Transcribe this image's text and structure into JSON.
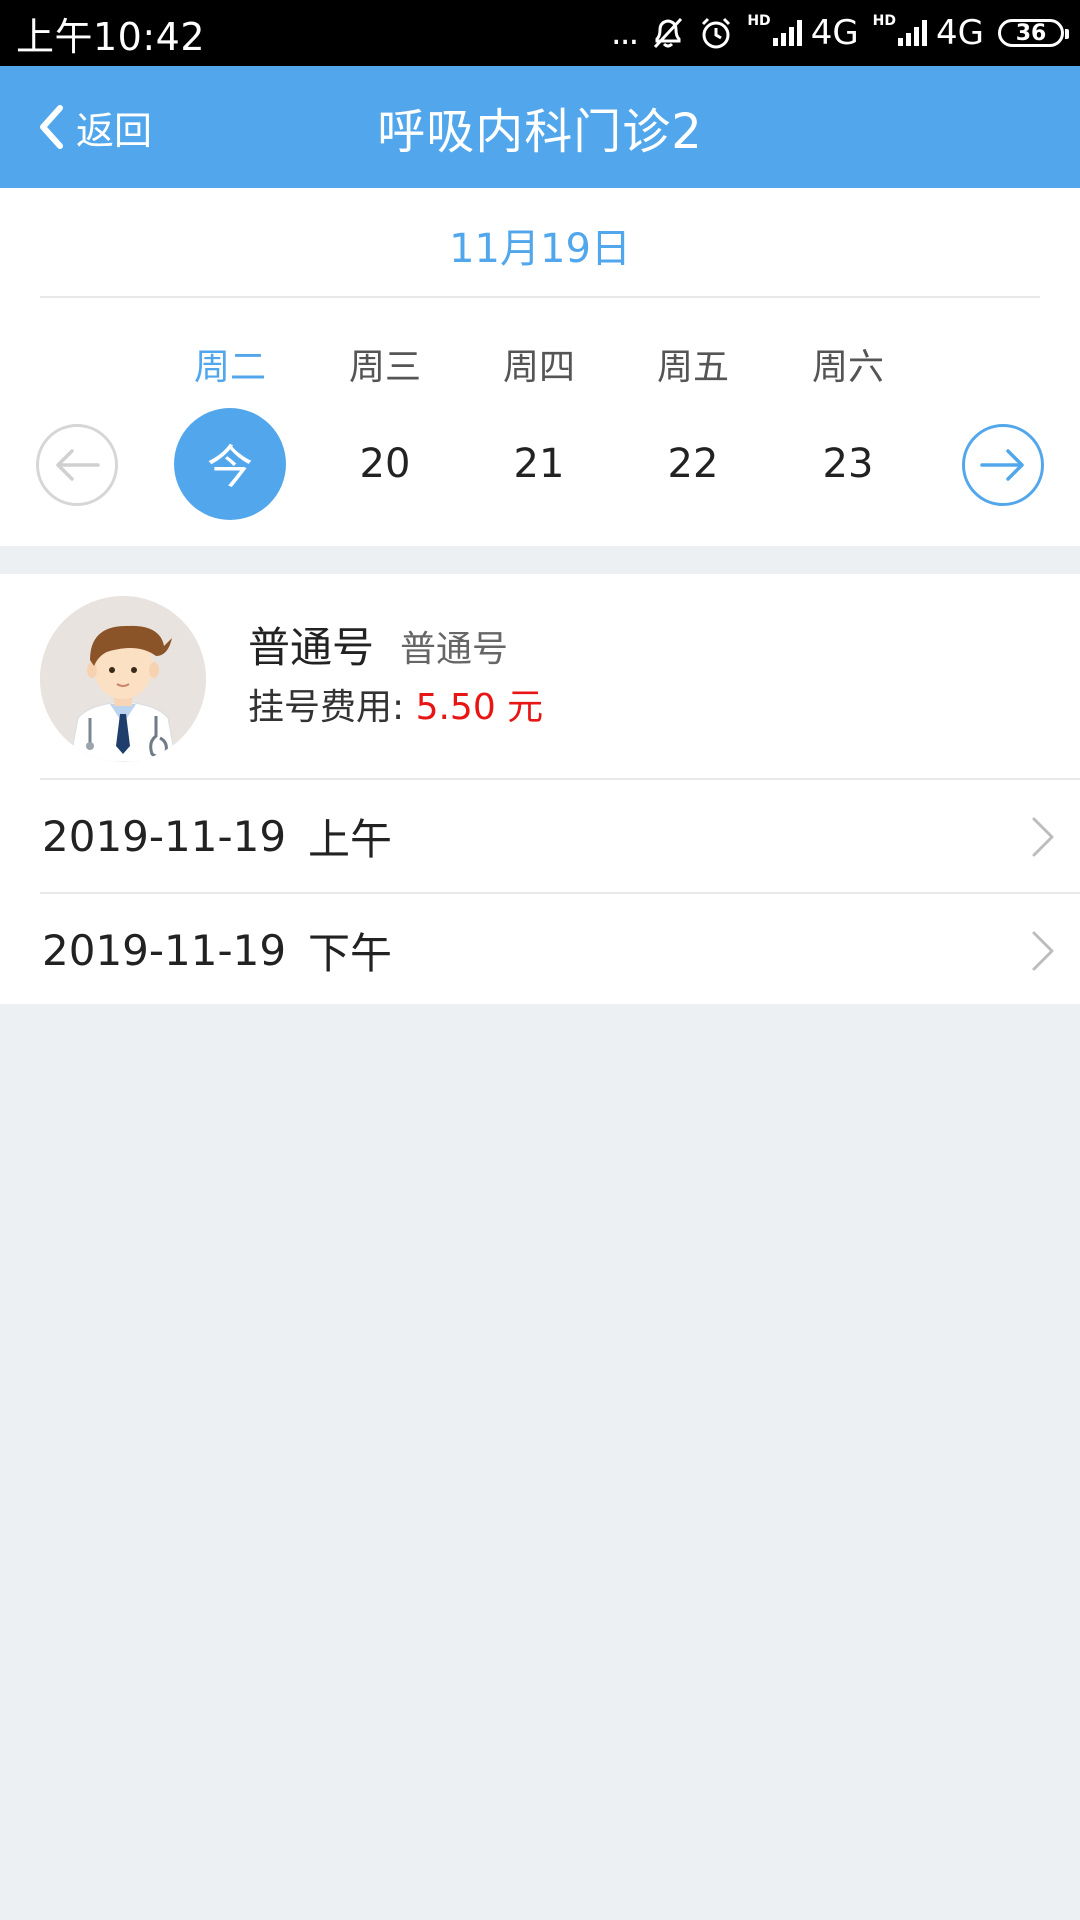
{
  "status_bar": {
    "time": "上午10:42",
    "dots": "...",
    "hd_label": "HD",
    "network_1": "4G",
    "network_2": "4G",
    "battery": "36"
  },
  "nav": {
    "back_label": "返回",
    "title": "呼吸内科门诊2"
  },
  "calendar": {
    "current_date": "11月19日",
    "weekdays": [
      "周二",
      "周三",
      "周四",
      "周五",
      "周六"
    ],
    "days": [
      "今",
      "20",
      "21",
      "22",
      "23"
    ],
    "selected_index": 0
  },
  "registration": {
    "type": "普通号",
    "subtype": "普通号",
    "fee_label": "挂号费用: ",
    "fee_value": "5.50 元"
  },
  "slots": [
    {
      "date": "2019-11-19",
      "period": "上午"
    },
    {
      "date": "2019-11-19",
      "period": "下午"
    }
  ],
  "colors": {
    "accent": "#52a7ec",
    "fee": "#e81515",
    "background": "#edf0f3"
  }
}
